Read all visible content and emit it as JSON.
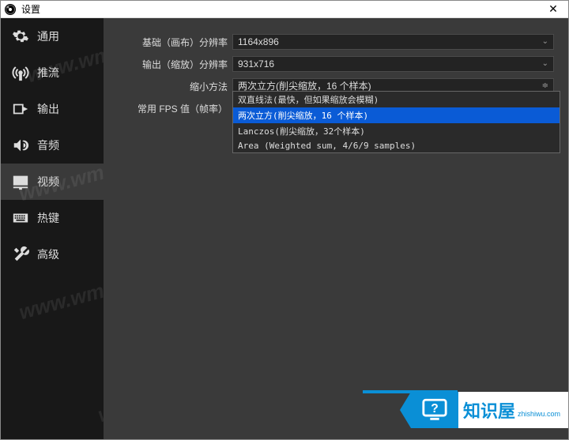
{
  "titlebar": {
    "title": "设置"
  },
  "sidebar": {
    "items": [
      {
        "id": "general",
        "label": "通用"
      },
      {
        "id": "stream",
        "label": "推流"
      },
      {
        "id": "output",
        "label": "输出"
      },
      {
        "id": "audio",
        "label": "音频"
      },
      {
        "id": "video",
        "label": "视频"
      },
      {
        "id": "hotkeys",
        "label": "热键"
      },
      {
        "id": "advanced",
        "label": "高级"
      }
    ]
  },
  "form": {
    "base_resolution": {
      "label": "基础（画布）分辨率",
      "value": "1164x896"
    },
    "output_resolution": {
      "label": "输出（缩放）分辨率",
      "value": "931x716"
    },
    "downscale_filter": {
      "label": "缩小方法",
      "value": "两次立方(削尖缩放，16 个样本)"
    },
    "fps": {
      "label": "常用 FPS 值（帧率）"
    }
  },
  "dropdown_options": [
    "双直线法(最快，但如果缩放会模糊)",
    "两次立方(削尖缩放，16 个样本)",
    "Lanczos(削尖缩放，32个样本)",
    "Area (Weighted sum, 4/6/9 samples)"
  ],
  "watermark": {
    "text": "www.wmzhe.com"
  },
  "banner": {
    "brand": "知识屋",
    "url": "zhishiwu.com"
  }
}
